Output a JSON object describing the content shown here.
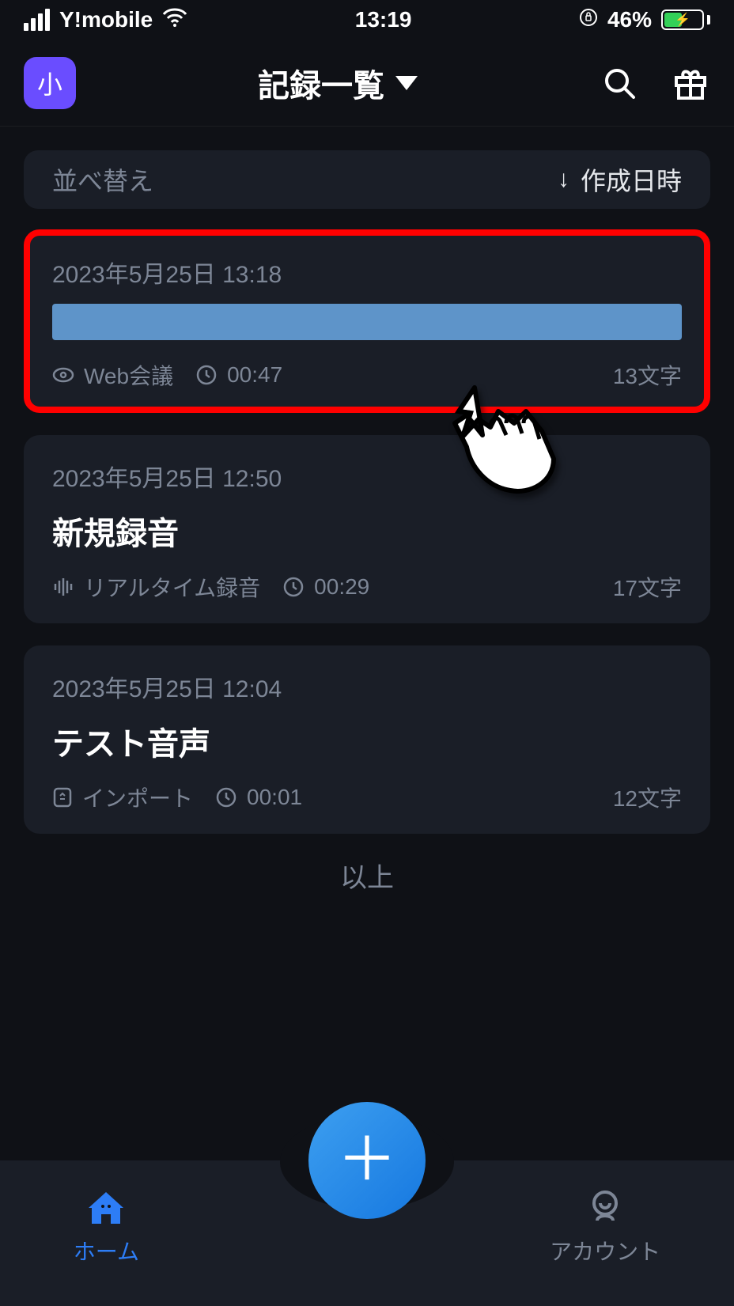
{
  "status": {
    "carrier": "Y!mobile",
    "time": "13:19",
    "battery_pct": "46%"
  },
  "header": {
    "avatar_label": "小",
    "title": "記録一覧"
  },
  "sort": {
    "label": "並べ替え",
    "value": "作成日時"
  },
  "records": [
    {
      "date": "2023年5月25日  13:18",
      "title_is_bar": true,
      "source": "Web会議",
      "source_icon": "web",
      "duration": "00:47",
      "chars": "13文字",
      "highlighted": true
    },
    {
      "date": "2023年5月25日  12:50",
      "title": "新規録音",
      "source": "リアルタイム録音",
      "source_icon": "wave",
      "duration": "00:29",
      "chars": "17文字"
    },
    {
      "date": "2023年5月25日  12:04",
      "title": "テスト音声",
      "source": "インポート",
      "source_icon": "import",
      "duration": "00:01",
      "chars": "12文字"
    }
  ],
  "end_label": "以上",
  "nav": {
    "home": "ホーム",
    "account": "アカウント"
  }
}
